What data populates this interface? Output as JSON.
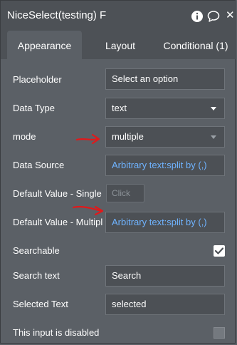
{
  "header": {
    "title": "NiceSelect(testing) F",
    "info_icon": "info-icon",
    "comment_icon": "comment-icon",
    "close_icon": "close-icon",
    "close_glyph": "✕"
  },
  "tabs": [
    {
      "label": "Appearance",
      "active": true
    },
    {
      "label": "Layout",
      "active": false
    },
    {
      "label": "Conditional (1)",
      "active": false
    }
  ],
  "fields": {
    "placeholder": {
      "label": "Placeholder",
      "value": "Select an option"
    },
    "data_type": {
      "label": "Data Type",
      "value": "text"
    },
    "mode": {
      "label": "mode",
      "value": "multiple"
    },
    "data_source": {
      "label": "Data Source",
      "value": "Arbitrary text:split by (,)"
    },
    "default_single": {
      "label": "Default Value - Single",
      "button": "Click"
    },
    "default_multiple": {
      "label": "Default Value - Multipl",
      "value": "Arbitrary text:split by (,)"
    },
    "searchable": {
      "label": "Searchable",
      "checked": true
    },
    "search_text": {
      "label": "Search text",
      "value": "Search"
    },
    "selected_text": {
      "label": "Selected Text",
      "value": "selected"
    },
    "disabled": {
      "label": "This input is disabled",
      "checked": false
    }
  },
  "colors": {
    "panel": "#5b6066",
    "header": "#4d5156",
    "field_bg": "#4c5055",
    "dynamic_text": "#6fb3ff",
    "annotation": "#e0191b"
  }
}
